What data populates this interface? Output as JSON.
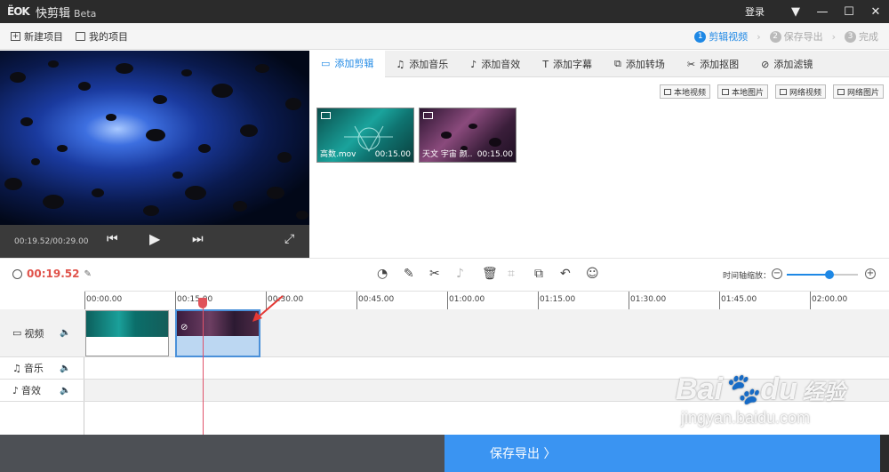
{
  "titlebar": {
    "logo": "ЁOK",
    "title": "快剪辑",
    "beta": "Beta",
    "login": "登录",
    "menu_icon": "▼",
    "minimize_icon": "—",
    "maximize_icon": "☐",
    "close_icon": "✕"
  },
  "toolbar2": {
    "new_project": "新建项目",
    "my_projects": "我的项目",
    "steps": [
      {
        "num": "1",
        "label": "剪辑视频"
      },
      {
        "num": "2",
        "label": "保存导出"
      },
      {
        "num": "3",
        "label": "完成"
      }
    ],
    "step_sep": "›"
  },
  "preview": {
    "timecode": "00:19.52/00:29.00"
  },
  "tabs": [
    {
      "icon": "▭",
      "label": "添加剪辑"
    },
    {
      "icon": "♫",
      "label": "添加音乐"
    },
    {
      "icon": "♪",
      "label": "添加音效"
    },
    {
      "icon": "T",
      "label": "添加字幕"
    },
    {
      "icon": "⧉",
      "label": "添加转场"
    },
    {
      "icon": "✂",
      "label": "添加抠图"
    },
    {
      "icon": "⊘",
      "label": "添加滤镜"
    }
  ],
  "media_buttons": [
    "本地视频",
    "本地图片",
    "网络视频",
    "网络图片"
  ],
  "media": [
    {
      "name": "高数.mov",
      "duration": "00:15.00"
    },
    {
      "name": "天文 宇宙 颜..",
      "duration": "00:15.00"
    }
  ],
  "timeline": {
    "current_time": "00:19.52",
    "zoom_label": "时间轴缩放：",
    "zoom_level": 0.6,
    "ruler": [
      "00:00.00",
      "00:15.00",
      "00:30.00",
      "00:45.00",
      "01:00.00",
      "01:15.00",
      "01:30.00",
      "01:45.00",
      "02:00.00"
    ],
    "tracks": [
      {
        "label": "视频"
      },
      {
        "label": "音乐"
      },
      {
        "label": "音效"
      }
    ]
  },
  "bottom": {
    "save_label": "保存导出 〉"
  },
  "watermark": {
    "line1": "Bai",
    "line1b": "du",
    "line1c": "经验",
    "line2": "jingyan.baidu.com"
  },
  "colors": {
    "accent": "#1e88e5",
    "time_red": "#e0524a",
    "save_blue": "#3a94f2"
  }
}
